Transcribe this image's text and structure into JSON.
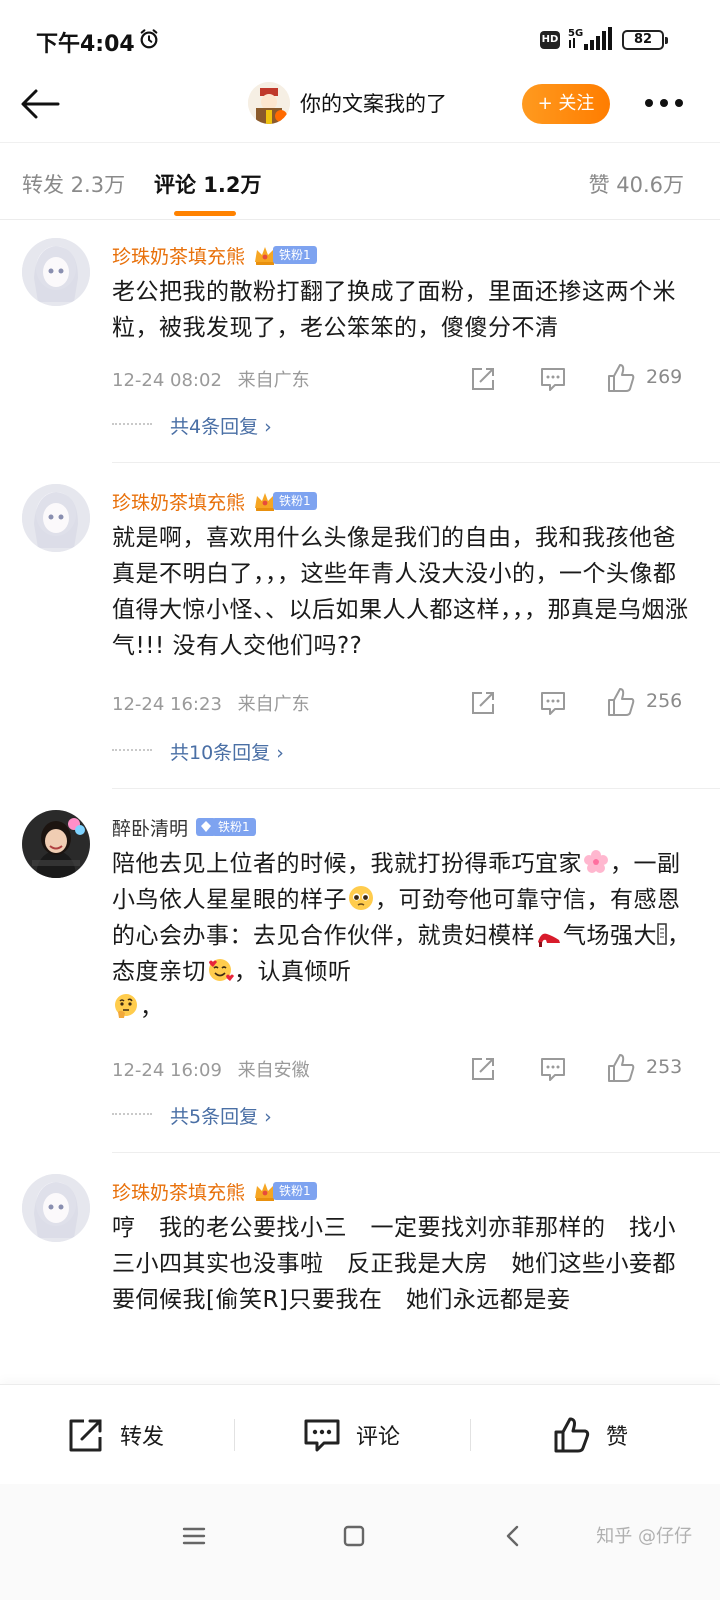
{
  "status_bar": {
    "time": "下午4:04",
    "network": "5G",
    "hd": "HD",
    "battery": "82"
  },
  "header": {
    "title": "你的文案我的了",
    "follow_label": "+ 关注"
  },
  "tabs": {
    "repost": "转发 2.3万",
    "comment": "评论 1.2万",
    "like": "赞 40.6万"
  },
  "comments": [
    {
      "username": "珍珠奶茶填充熊",
      "fan_badge": "铁粉1",
      "text": "老公把我的散粉打翻了换成了面粉，里面还掺这两个米粒，被我发现了，老公笨笨的，傻傻分不清",
      "time": "12-24 08:02",
      "location": "来自广东",
      "likes": "269",
      "replies": "共4条回复 ›"
    },
    {
      "username": "珍珠奶茶填充熊",
      "fan_badge": "铁粉1",
      "text": "就是啊，喜欢用什么头像是我们的自由，我和我孩他爸真是不明白了，，，这些年青人没大没小的，一个头像都值得大惊小怪、、以后如果人人都这样，，，那真是乌烟涨气!!! 没有人交他们吗??",
      "time": "12-24 16:23",
      "location": "来自广东",
      "likes": "256",
      "replies": "共10条回复 ›"
    },
    {
      "username": "醉卧清明",
      "fan_badge": "铁粉1",
      "text_parts": [
        "陪他去见上位者的时候，我就打扮得乖巧宜家",
        "，一副小鸟依人星星眼的样子",
        "，可劲夸他可靠守信，有感恩的心会办事：去见合作伙伴，就贵妇模样",
        "气场强大",
        "，态度亲切",
        "，认真倾听",
        "，"
      ],
      "time": "12-24 16:09",
      "location": "来自安徽",
      "likes": "253",
      "replies": "共5条回复 ›"
    },
    {
      "username": "珍珠奶茶填充熊",
      "fan_badge": "铁粉1",
      "text": "哼　我的老公要找小三　一定要找刘亦菲那样的　找小三小四其实也没事啦　反正我是大房　她们这些小妾都要伺候我[偷笑R]只要我在　她们永远都是妾"
    }
  ],
  "bottom_bar": {
    "repost": "转发",
    "comment": "评论",
    "like": "赞"
  },
  "watermark": "知乎 @仔仔",
  "colors": {
    "accent": "#ff8200",
    "username": "#e8700a",
    "reply_link": "#4a6fa5"
  }
}
